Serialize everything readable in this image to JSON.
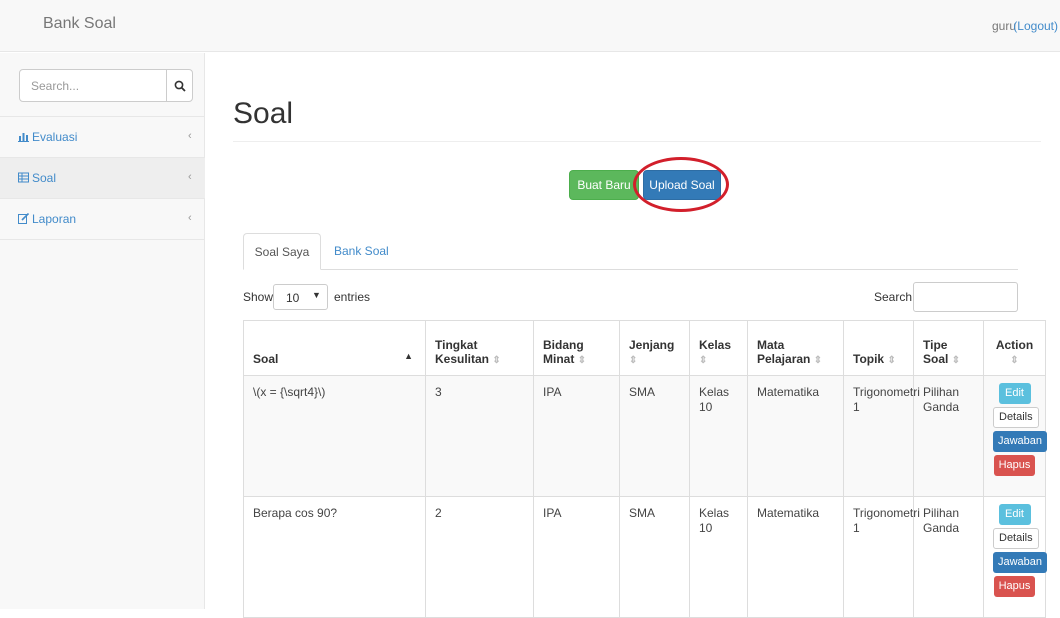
{
  "navbar": {
    "brand": "Bank Soal",
    "user": "guru",
    "logout": "(Logout)"
  },
  "sidebar": {
    "search_placeholder": "Search...",
    "items": [
      {
        "label": "Evaluasi",
        "icon": "bar-chart-icon",
        "chevron": "‹"
      },
      {
        "label": "Soal",
        "icon": "table-icon",
        "chevron": "‹"
      },
      {
        "label": "Laporan",
        "icon": "edit-icon",
        "chevron": "‹"
      }
    ]
  },
  "main": {
    "title": "Soal",
    "buttons": {
      "new": "Buat Baru",
      "upload": "Upload Soal"
    },
    "tabs": [
      "Soal Saya",
      "Bank Soal"
    ],
    "datatable": {
      "show": "Show",
      "length": "10",
      "entries": "entries",
      "search": "Search:"
    },
    "columns": [
      "Soal",
      "Tingkat Kesulitan",
      "Bidang Minat",
      "Jenjang",
      "Kelas",
      "Mata Pelajaran",
      "Topik",
      "Tipe Soal",
      "Action"
    ],
    "rows": [
      {
        "soal": "\\(x = {\\sqrt4}\\)",
        "tingkat": "3",
        "bidang": "IPA",
        "jenjang": "SMA",
        "kelas": "Kelas 10",
        "mapel": "Matematika",
        "topik": "Trigonometri 1",
        "tipe": "Pilihan Ganda"
      },
      {
        "soal": "Berapa cos 90?",
        "tingkat": "2",
        "bidang": "IPA",
        "jenjang": "SMA",
        "kelas": "Kelas 10",
        "mapel": "Matematika",
        "topik": "Trigonometri 1",
        "tipe": "Pilihan Ganda"
      }
    ],
    "actions": {
      "edit": "Edit",
      "details": "Details",
      "jawaban": "Jawaban",
      "hapus": "Hapus"
    }
  },
  "colors": {
    "accent_link": "#428bca",
    "success": "#5cb85c",
    "primary": "#337ab7",
    "info": "#5bc0de",
    "danger": "#d9534f",
    "annotation": "#d21f2b"
  }
}
